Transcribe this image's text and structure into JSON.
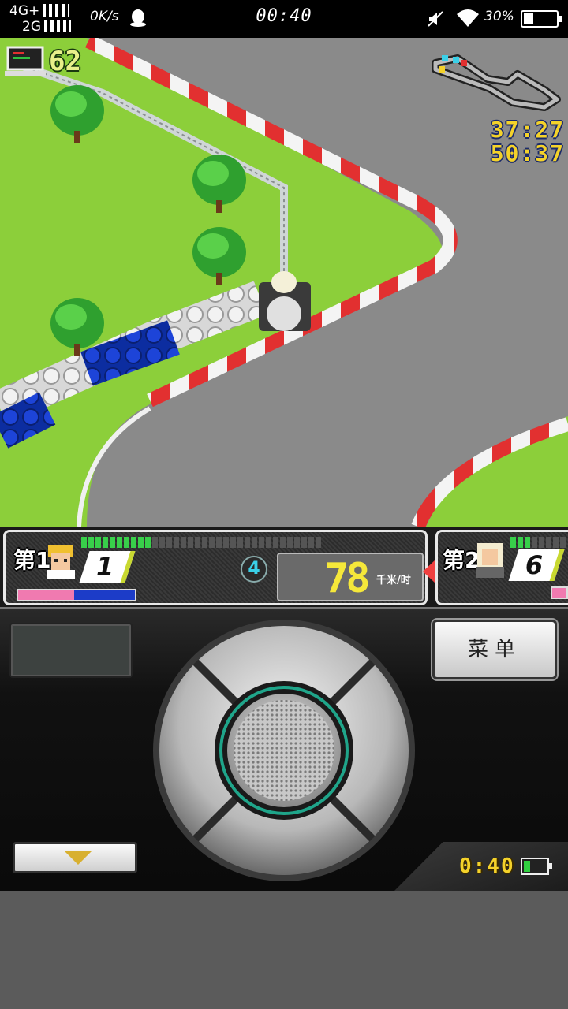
{
  "status_bar": {
    "network_top": "4G+",
    "network_bottom": "2G",
    "data_speed": "0K/s",
    "time": "00:40",
    "battery_percent": "30%",
    "battery_level": 0.3,
    "icons": [
      "signal-icon",
      "qq-icon",
      "mute-icon",
      "wifi-icon",
      "battery-icon"
    ]
  },
  "game": {
    "pit_counter": "62",
    "lap_times": [
      "37:27",
      "50:37"
    ],
    "minimap_icon": "track-minimap"
  },
  "hud": {
    "player": {
      "position_label": "第1",
      "number": "1",
      "boost_level": 0.48,
      "segments_total": 34,
      "segments_on": 10
    },
    "gear": "4",
    "speed": "78",
    "speed_unit": "千米/时",
    "rival": {
      "position_label": "第2",
      "number": "6",
      "segments_on": 3
    }
  },
  "controller": {
    "menu_label": "菜单",
    "game_clock": "0:40",
    "game_battery_level": 0.25,
    "colors": {
      "speed": "#f6e83a",
      "timer": "#f4d22a",
      "boost": "#f07ab0"
    }
  }
}
